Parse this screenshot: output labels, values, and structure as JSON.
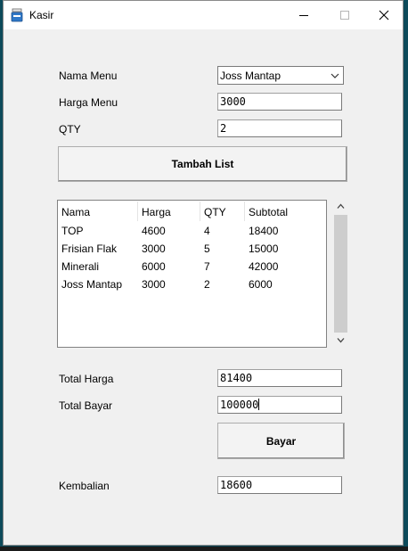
{
  "window": {
    "title": "Kasir"
  },
  "form": {
    "nama_menu_label": "Nama Menu",
    "nama_menu_value": "Joss Mantap",
    "harga_menu_label": "Harga Menu",
    "harga_menu_value": "3000",
    "qty_label": "QTY",
    "qty_value": "2",
    "tambah_button": "Tambah List"
  },
  "list": {
    "headers": [
      "Nama",
      "Harga",
      "QTY",
      "Subtotal"
    ],
    "rows": [
      [
        "TOP",
        "4600",
        "4",
        "18400"
      ],
      [
        "Frisian Flak",
        "3000",
        "5",
        "15000"
      ],
      [
        "Minerali",
        "6000",
        "7",
        "42000"
      ],
      [
        "Joss Mantap",
        "3000",
        "2",
        "6000"
      ]
    ]
  },
  "totals": {
    "total_harga_label": "Total Harga",
    "total_harga_value": "81400",
    "total_bayar_label": "Total Bayar",
    "total_bayar_value": "100000",
    "bayar_button": "Bayar",
    "kembalian_label": "Kembalian",
    "kembalian_value": "18600"
  },
  "icons": {
    "app": "app-icon",
    "minimize": "minimize-icon",
    "maximize": "maximize-icon",
    "close": "close-icon",
    "dropdown": "chevron-down-icon",
    "scroll_up": "scroll-up-arrow-icon",
    "scroll_down": "scroll-down-arrow-icon"
  }
}
